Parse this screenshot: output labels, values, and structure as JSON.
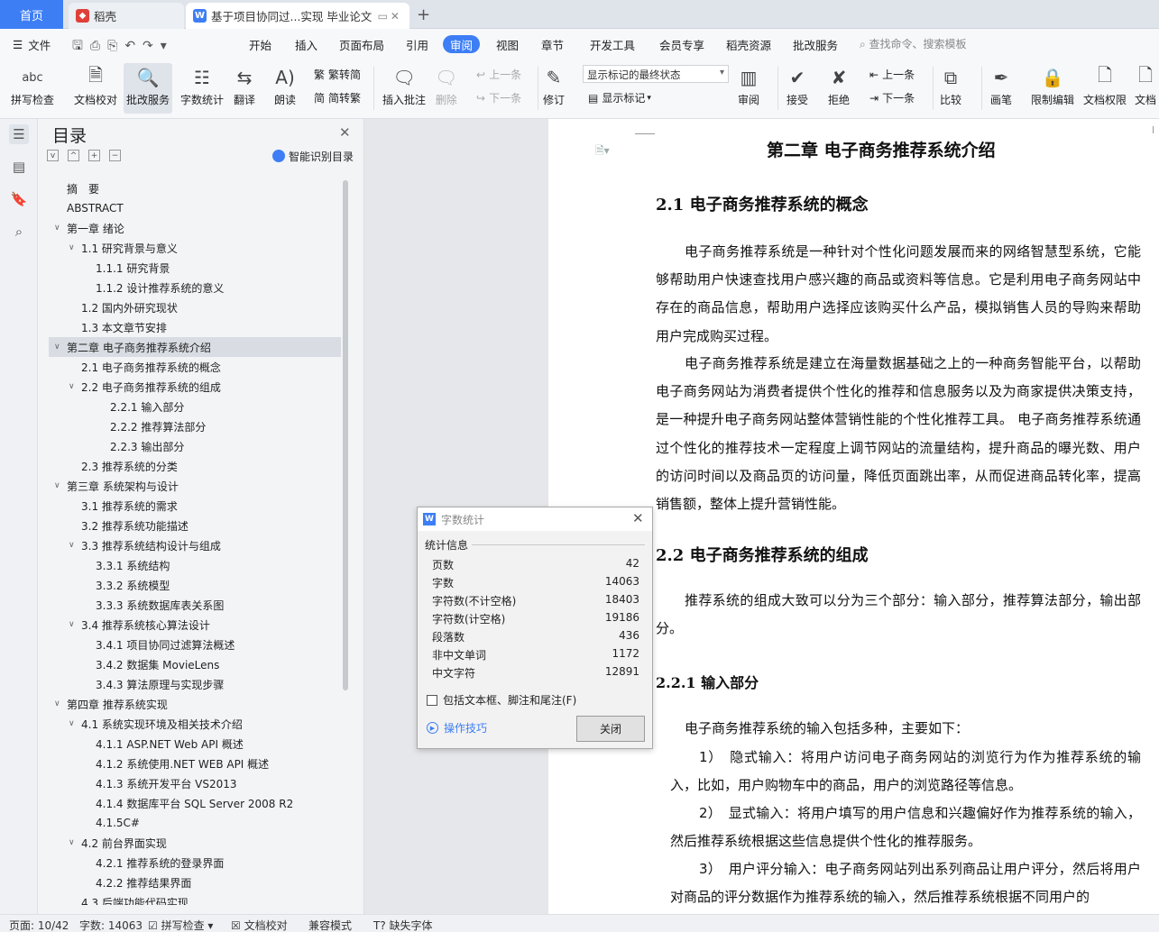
{
  "tabs": {
    "home": "首页",
    "tab1": "稻壳",
    "tab2": "基于项目协同过...实现 毕业论文"
  },
  "menu": {
    "file": "文件",
    "items": [
      "开始",
      "插入",
      "页面布局",
      "引用",
      "审阅",
      "视图",
      "章节",
      "开发工具",
      "会员专享",
      "稻壳资源",
      "批改服务"
    ],
    "active": "审阅",
    "search": "查找命令、搜索模板"
  },
  "ribbon": {
    "spell": "拼写检查",
    "doccheck": "文档校对",
    "review_service": "批改服务",
    "wordcount": "字数统计",
    "translate": "翻译",
    "read": "朗读",
    "t2s": "繁转简",
    "s2t": "简转繁",
    "insert_comment": "插入批注",
    "delete": "删除",
    "prev": "上一条",
    "next": "下一条",
    "revise": "修订",
    "markup_mode": "显示标记的最终状态",
    "show_markup": "显示标记",
    "review": "审阅",
    "accept": "接受",
    "reject": "拒绝",
    "prev2": "上一条",
    "next2": "下一条",
    "compare": "比较",
    "pen": "画笔",
    "restrict": "限制编辑",
    "doc_perm": "文档权限",
    "doc_more": "文档"
  },
  "toc": {
    "title": "目录",
    "smart": "智能识别目录",
    "items": [
      {
        "text": "摘　要",
        "level": 0,
        "car": ""
      },
      {
        "text": "ABSTRACT",
        "level": 0,
        "car": ""
      },
      {
        "text": "第一章  绪论",
        "level": 0,
        "car": "v"
      },
      {
        "text": "1.1 研究背景与意义",
        "level": 1,
        "car": "v"
      },
      {
        "text": "1.1.1  研究背景",
        "level": 2,
        "car": ""
      },
      {
        "text": "1.1.2  设计推荐系统的意义",
        "level": 2,
        "car": ""
      },
      {
        "text": "1.2  国内外研究现状",
        "level": 1,
        "car": ""
      },
      {
        "text": "1.3  本文章节安排",
        "level": 1,
        "car": ""
      },
      {
        "text": "第二章  电子商务推荐系统介绍",
        "level": 0,
        "car": "v",
        "selected": true
      },
      {
        "text": "2.1 电子商务推荐系统的概念",
        "level": 1,
        "car": ""
      },
      {
        "text": "2.2 电子商务推荐系统的组成",
        "level": 1,
        "car": "v"
      },
      {
        "text": "2.2.1 输入部分",
        "level": 3,
        "car": ""
      },
      {
        "text": "2.2.2 推荐算法部分",
        "level": 3,
        "car": ""
      },
      {
        "text": "2.2.3 输出部分",
        "level": 3,
        "car": ""
      },
      {
        "text": "2.3 推荐系统的分类",
        "level": 1,
        "car": ""
      },
      {
        "text": "第三章  系统架构与设计",
        "level": 0,
        "car": "v"
      },
      {
        "text": "3.1 推荐系统的需求",
        "level": 1,
        "car": ""
      },
      {
        "text": "3.2 推荐系统功能描述",
        "level": 1,
        "car": ""
      },
      {
        "text": "3.3  推荐系统结构设计与组成",
        "level": 1,
        "car": "v"
      },
      {
        "text": "3.3.1  系统结构",
        "level": 2,
        "car": ""
      },
      {
        "text": "3.3.2  系统模型",
        "level": 2,
        "car": ""
      },
      {
        "text": "3.3.3  系统数据库表关系图",
        "level": 2,
        "car": ""
      },
      {
        "text": "3.4  推荐系统核心算法设计",
        "level": 1,
        "car": "v"
      },
      {
        "text": "3.4.1  项目协同过滤算法概述",
        "level": 2,
        "car": ""
      },
      {
        "text": "3.4.2 数据集 MovieLens",
        "level": 2,
        "car": ""
      },
      {
        "text": "3.4.3 算法原理与实现步骤",
        "level": 2,
        "car": ""
      },
      {
        "text": "第四章  推荐系统实现",
        "level": 0,
        "car": "v"
      },
      {
        "text": "4.1  系统实现环境及相关技术介绍",
        "level": 1,
        "car": "v"
      },
      {
        "text": "4.1.1 ASP.NET Web API 概述",
        "level": 2,
        "car": ""
      },
      {
        "text": "4.1.2  系统使用.NET    WEB API 概述",
        "level": 2,
        "car": ""
      },
      {
        "text": "4.1.3 系统开发平台  VS2013",
        "level": 2,
        "car": ""
      },
      {
        "text": "4.1.4 数据库平台  SQL Server 2008 R2",
        "level": 2,
        "car": ""
      },
      {
        "text": "4.1.5C#",
        "level": 2,
        "car": ""
      },
      {
        "text": "4.2 前台界面实现",
        "level": 1,
        "car": "v"
      },
      {
        "text": "4.2.1  推荐系统的登录界面",
        "level": 2,
        "car": ""
      },
      {
        "text": "4.2.2  推荐结果界面",
        "level": 2,
        "car": ""
      },
      {
        "text": "4.3  后端功能代码实现",
        "level": 1,
        "car": ""
      }
    ]
  },
  "doc": {
    "chapter": "第二章  电子商务推荐系统介绍",
    "h21": "2.1 电子商务推荐系统的概念",
    "p1": "电子商务推荐系统是一种针对个性化问题发展而来的网络智慧型系统，它能够帮助用户快速查找用户感兴趣的商品或资料等信息。它是利用电子商务网站中存在的商品信息，帮助用户选择应该购买什么产品，模拟销售人员的导购来帮助用户完成购买过程。",
    "p2": "电子商务推荐系统是建立在海量数据基础之上的一种商务智能平台，以帮助电子商务网站为消费者提供个性化的推荐和信息服务以及为商家提供决策支持，是一种提升电子商务网站整体营销性能的个性化推荐工具。 电子商务推荐系统通过个性化的推荐技术一定程度上调节网站的流量结构，提升商品的曝光数、用户的访问时间以及商品页的访问量，降低页面跳出率，从而促进商品转化率，提高销售额，整体上提升营销性能。",
    "h22": "2.2 电子商务推荐系统的组成",
    "p3": "推荐系统的组成大致可以分为三个部分：输入部分，推荐算法部分，输出部分。",
    "h221": "2.2.1 输入部分",
    "p4": "电子商务推荐系统的输入包括多种，主要如下：",
    "l1": "1）　隐式输入：将用户访问电子商务网站的浏览行为作为推荐系统的输入，比如，用户购物车中的商品，用户的浏览路径等信息。",
    "l2": "2）　显式输入：将用户填写的用户信息和兴趣偏好作为推荐系统的输入，然后推荐系统根据这些信息提供个性化的推荐服务。",
    "l3": "3）　用户评分输入：电子商务网站列出系列商品让用户评分，然后将用户对商品的评分数据作为推荐系统的输入，然后推荐系统根据不同用户的"
  },
  "dialog": {
    "title": "字数统计",
    "section": "统计信息",
    "rows": [
      {
        "label": "页数",
        "value": "42"
      },
      {
        "label": "字数",
        "value": "14063"
      },
      {
        "label": "字符数(不计空格)",
        "value": "18403"
      },
      {
        "label": "字符数(计空格)",
        "value": "19186"
      },
      {
        "label": "段落数",
        "value": "436"
      },
      {
        "label": "非中文单词",
        "value": "1172"
      },
      {
        "label": "中文字符",
        "value": "12891"
      }
    ],
    "checkbox": "包括文本框、脚注和尾注(F)",
    "tips": "操作技巧",
    "close": "关闭"
  },
  "status": {
    "page": "页面: 10/42",
    "words": "字数: 14063",
    "spell": "拼写检查",
    "doccheck": "文档校对",
    "compat": "兼容模式",
    "font_missing": "缺失字体"
  }
}
